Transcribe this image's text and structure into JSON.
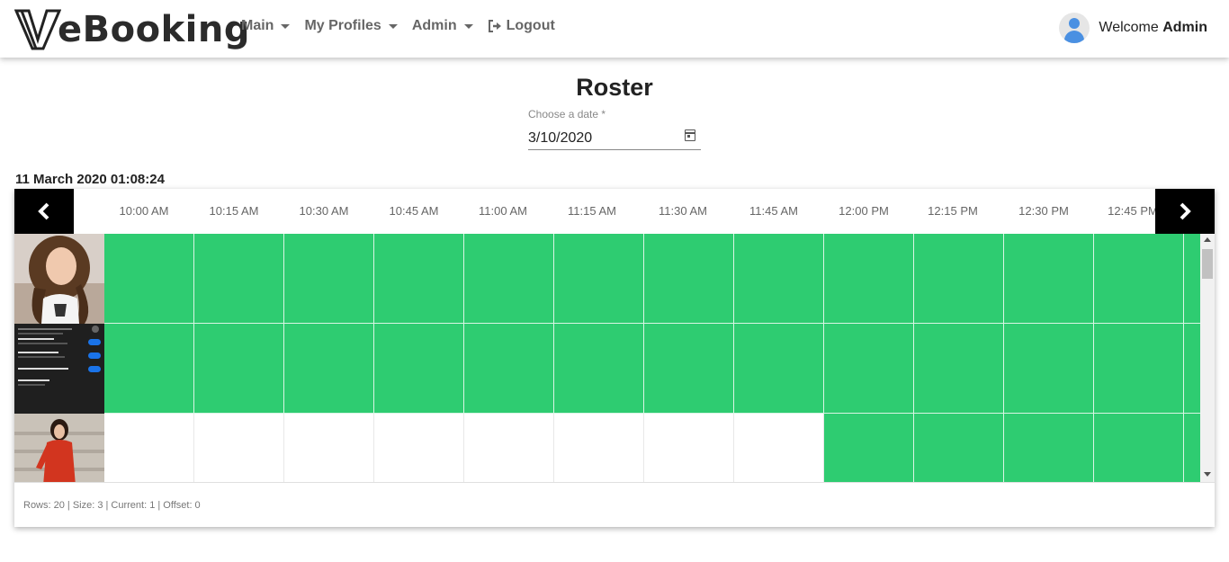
{
  "brand": {
    "name": "eBooking"
  },
  "nav": {
    "items": [
      {
        "label": "Main",
        "dropdown": true
      },
      {
        "label": "My Profiles",
        "dropdown": true
      },
      {
        "label": "Admin",
        "dropdown": true
      },
      {
        "label": "Logout",
        "icon": "logout-icon"
      }
    ]
  },
  "user": {
    "greeting": "Welcome",
    "name": "Admin",
    "icon": "user-avatar-icon"
  },
  "page": {
    "title": "Roster",
    "date_label": "Choose a date *",
    "date_value": "3/10/2020",
    "timestamp": "11 March 2020 01:08:24"
  },
  "roster": {
    "times": [
      "10:00 AM",
      "10:15 AM",
      "10:30 AM",
      "10:45 AM",
      "11:00 AM",
      "11:15 AM",
      "11:30 AM",
      "11:45 AM",
      "12:00 PM",
      "12:15 PM",
      "12:30 PM",
      "12:45 PM"
    ],
    "rows": [
      {
        "photo": "profile-photo-woman-brown-hair",
        "slots": [
          1,
          1,
          1,
          1,
          1,
          1,
          1,
          1,
          1,
          1,
          1,
          1,
          1
        ]
      },
      {
        "photo": "profile-photo-settings-screenshot",
        "slots": [
          1,
          1,
          1,
          1,
          1,
          1,
          1,
          1,
          1,
          1,
          1,
          1,
          1
        ]
      },
      {
        "photo": "profile-photo-woman-red-dress",
        "slots": [
          0,
          0,
          0,
          0,
          0,
          0,
          0,
          0,
          1,
          1,
          1,
          1,
          1
        ]
      }
    ],
    "available_color": "#2ecc71",
    "footer": "Rows: 20 | Size: 3 | Current: 1 | Offset: 0"
  }
}
